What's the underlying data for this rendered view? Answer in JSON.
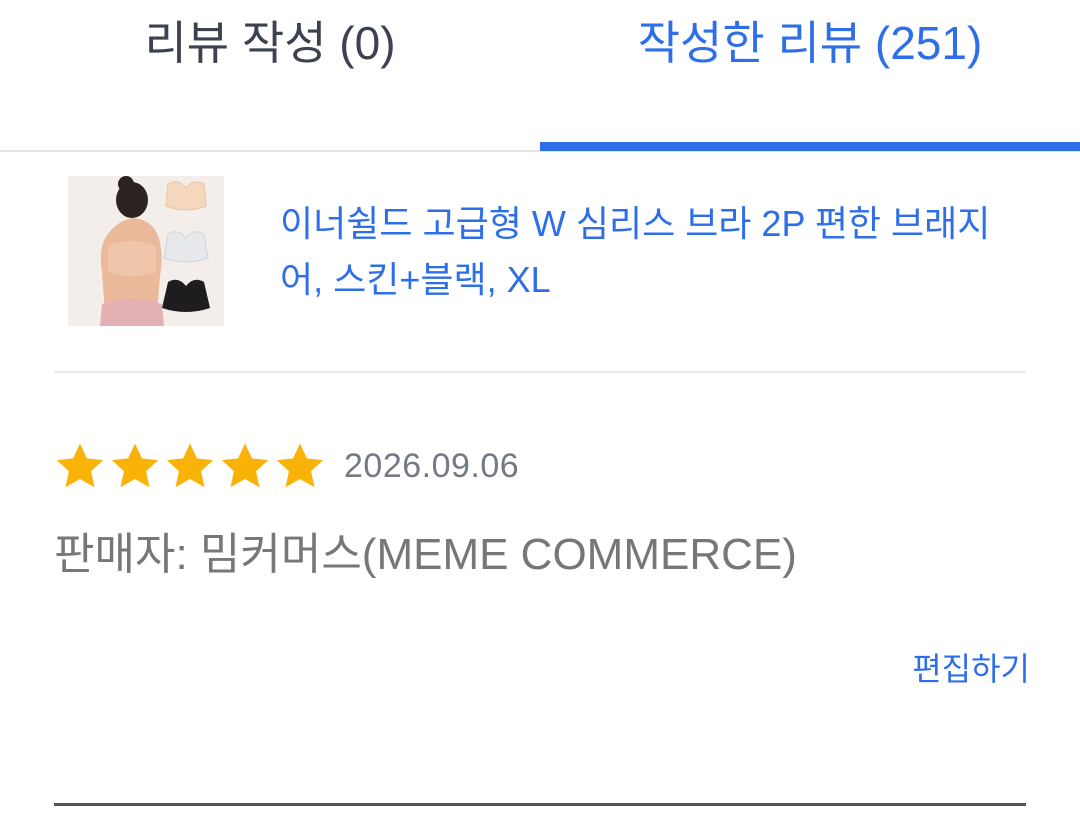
{
  "tabs": [
    {
      "label": "리뷰 작성 (0)",
      "active": false
    },
    {
      "label": "작성한 리뷰 (251)",
      "active": true
    }
  ],
  "product": {
    "image_icon": "product-photo-bras",
    "name": "이너쉴드 고급형 W 심리스 브라 2P 편한 브래지어, 스킨+블랙, XL"
  },
  "review": {
    "rating": 5,
    "rating_max": 5,
    "date": "2026.09.06",
    "seller": "판매자: 밈커머스(MEME COMMERCE)",
    "edit_label": "편집하기"
  },
  "colors": {
    "accent": "#2e6ee8",
    "star": "#f9b208",
    "muted_text": "#777777"
  }
}
